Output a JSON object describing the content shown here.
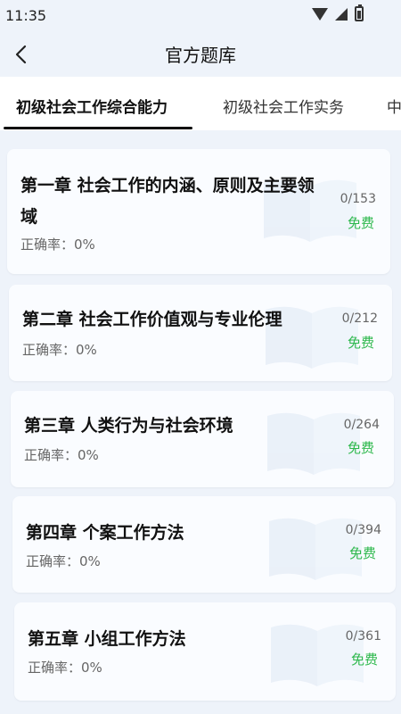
{
  "status": {
    "time": "11:35"
  },
  "header": {
    "title": "官方题库"
  },
  "tabs": [
    {
      "label": "初级社会工作综合能力",
      "active": true
    },
    {
      "label": "初级社会工作实务",
      "active": false
    },
    {
      "label": "中",
      "active": false
    }
  ],
  "chapters": [
    {
      "title": "第一章 社会工作的内涵、原则及主要领域",
      "rate": "正确率：0%",
      "count": "0/153",
      "free": "免费"
    },
    {
      "title": "第二章 社会工作价值观与专业伦理",
      "rate": "正确率：0%",
      "count": "0/212",
      "free": "免费"
    },
    {
      "title": "第三章 人类行为与社会环境",
      "rate": "正确率：0%",
      "count": "0/264",
      "free": "免费"
    },
    {
      "title": "第四章 个案工作方法",
      "rate": "正确率：0%",
      "count": "0/394",
      "free": "免费"
    },
    {
      "title": "第五章 小组工作方法",
      "rate": "正确率：0%",
      "count": "0/361",
      "free": "免费"
    }
  ],
  "colors": {
    "accent_free": "#2db84c",
    "background": "#eef3fa",
    "card": "#fafcff"
  },
  "icons": {
    "back": "chevron-left-icon",
    "wifi": "wifi-icon",
    "signal": "signal-icon",
    "battery": "battery-icon",
    "card_decoration": "book-icon"
  }
}
